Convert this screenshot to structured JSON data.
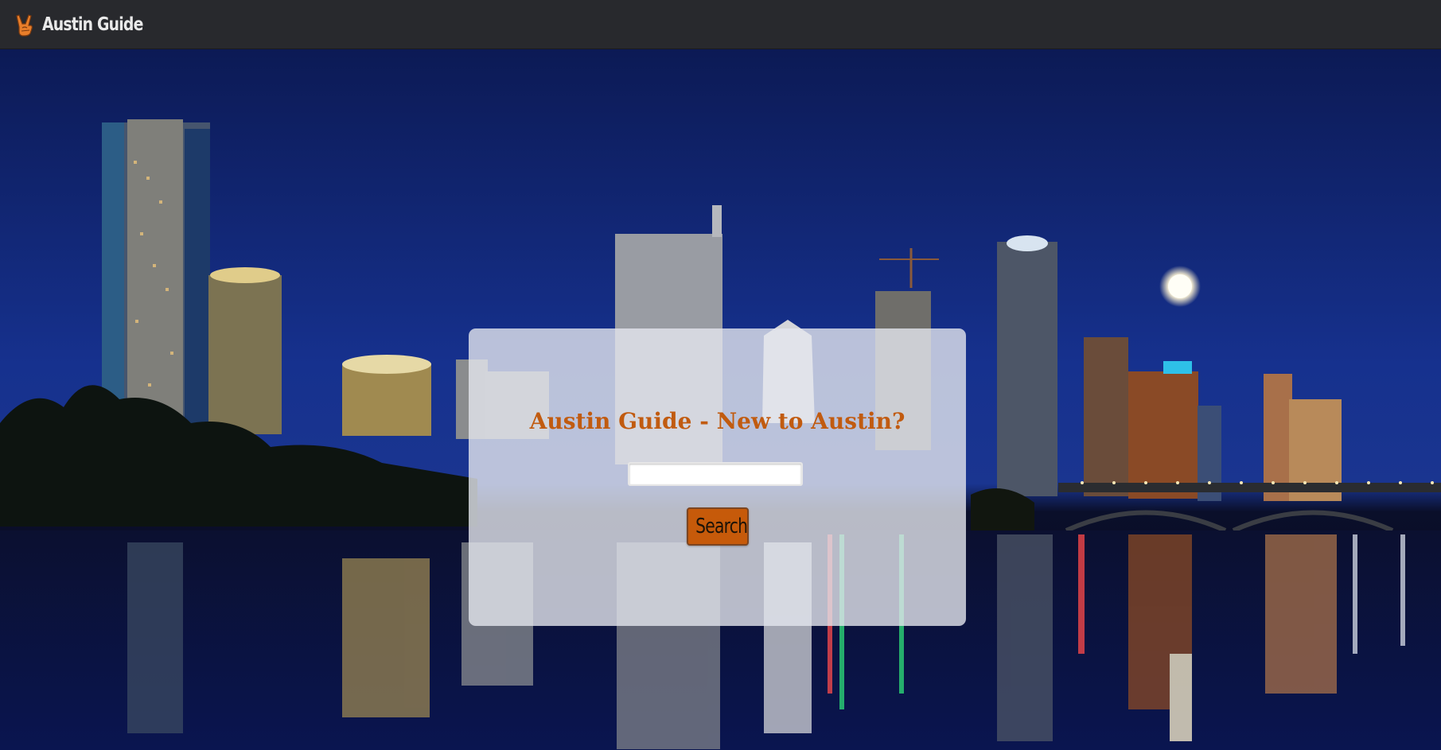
{
  "navbar": {
    "brand_label": "Austin Guide",
    "brand_icon": "rock-on-hand-icon",
    "background_color": "#28292d"
  },
  "hero": {
    "background": "austin-skyline-night-photo"
  },
  "panel": {
    "title": "Austin Guide - New to Austin?",
    "title_color": "#c15b10",
    "search_input": {
      "value": "",
      "placeholder": ""
    },
    "search_button_label": "Search",
    "button_color": "#c65a0a"
  }
}
